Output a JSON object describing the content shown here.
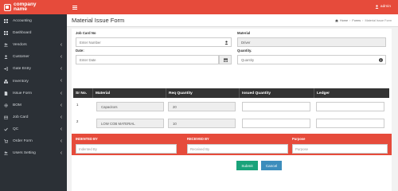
{
  "app": {
    "logo_line1": "company",
    "logo_line2": "name"
  },
  "topbar": {
    "user": "admin"
  },
  "sidebar": {
    "items": [
      {
        "label": "Accounting",
        "icon": "dashboard-icon",
        "chevron": false
      },
      {
        "label": "Dashboard",
        "icon": "dashboard-icon",
        "chevron": false
      },
      {
        "label": "Vendors",
        "icon": "users-icon",
        "chevron": true
      },
      {
        "label": "Customer",
        "icon": "user-icon",
        "chevron": true
      },
      {
        "label": "Gate Entry",
        "icon": "sign-in-icon",
        "chevron": true
      },
      {
        "label": "Inventory",
        "icon": "cubes-icon",
        "chevron": true
      },
      {
        "label": "Issue Form",
        "icon": "file-icon",
        "chevron": true
      },
      {
        "label": "BOM",
        "icon": "gear-icon",
        "chevron": true
      },
      {
        "label": "Job Card",
        "icon": "card-icon",
        "chevron": true
      },
      {
        "label": "QC",
        "icon": "check-icon",
        "chevron": true
      },
      {
        "label": "Order Form",
        "icon": "cart-icon",
        "chevron": true
      },
      {
        "label": "Users Setting",
        "icon": "users-icon",
        "chevron": true
      }
    ]
  },
  "page": {
    "title": "Material Issue Form",
    "breadcrumb": [
      "Home",
      "Forms",
      "Material Issue Form"
    ]
  },
  "form": {
    "job_card_label": "Job Card No",
    "job_card_placeholder": "Enter Number",
    "material_label": "Material",
    "material_value": "Driver",
    "date_label": "Date:",
    "date_placeholder": "Enter Date",
    "quantity_label": "Quantity.",
    "quantity_placeholder": "Quantity"
  },
  "table": {
    "headers": [
      "Sr No.",
      "Material",
      "Req Quantity",
      "Issued Quantity",
      "Ledger"
    ],
    "rows": [
      {
        "sr": "1",
        "material": "Capacitors",
        "req": "20"
      },
      {
        "sr": "2",
        "material": "LOW COB MATERIAL",
        "req": "10"
      }
    ]
  },
  "band": {
    "indented_label": "INDENTED BY",
    "indented_placeholder": "Indented By",
    "received_label": "RECEIVED BY",
    "received_placeholder": "Received By",
    "purpose_label": "Purpose",
    "purpose_placeholder": "Purpose"
  },
  "buttons": {
    "submit": "Submit",
    "cancel": "Cancel"
  },
  "colors": {
    "brand": "#e64b3b",
    "sidebar": "#2b3036",
    "submit": "#1aa37a",
    "cancel": "#3c8dbc"
  }
}
